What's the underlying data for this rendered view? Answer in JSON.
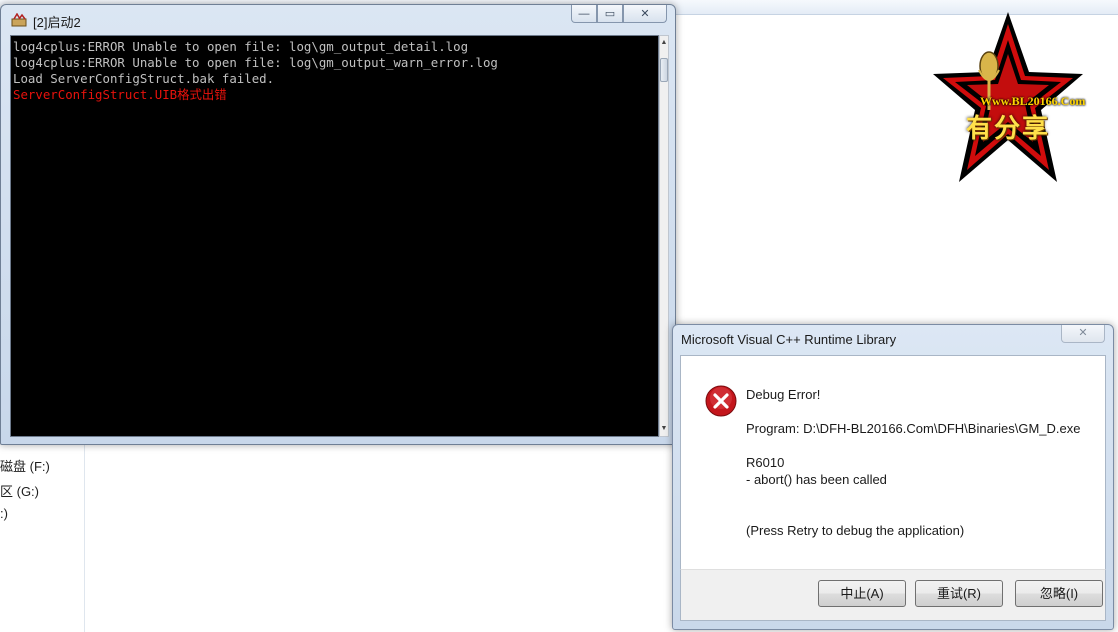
{
  "explorer": {
    "nav_items": [
      {
        "label": "磁盘 (F:)"
      },
      {
        "label": "区 (G:)"
      },
      {
        "label": ":)"
      }
    ]
  },
  "console": {
    "title": "[2]启动2",
    "caption_buttons": {
      "minimize": "—",
      "restore": "▭",
      "close": "✕"
    },
    "lines": [
      "log4cplus:ERROR Unable to open file: log\\gm_output_detail.log",
      "log4cplus:ERROR Unable to open file: log\\gm_output_warn_error.log",
      "Load ServerConfigStruct.bak failed."
    ],
    "error_line": "ServerConfigStruct.UIB格式出错",
    "colors": {
      "text": "#c0c0c0",
      "error": "#e8120c",
      "background": "#000000"
    }
  },
  "logo": {
    "url_text": "Www.BL20166.Com",
    "script_text": "有分享",
    "icon": "star-microphone-logo"
  },
  "dialog": {
    "title": "Microsoft Visual C++ Runtime Library",
    "close_label": "✕",
    "icon": "error-x-icon",
    "heading": "Debug Error!",
    "program_line": "Program: D:\\DFH-BL20166.Com\\DFH\\Binaries\\GM_D.exe",
    "code": "R6010",
    "message": "- abort() has been called",
    "hint": "(Press Retry to debug the application)",
    "buttons": {
      "abort": "中止(A)",
      "retry": "重试(R)",
      "ignore": "忽略(I)"
    }
  }
}
